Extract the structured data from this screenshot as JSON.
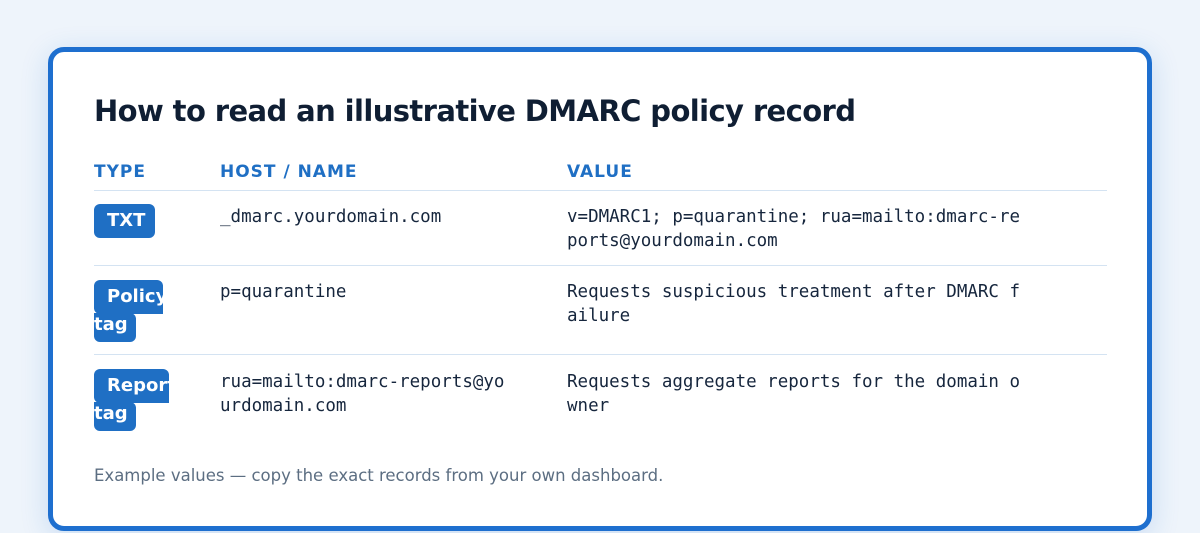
{
  "card": {
    "title": "How to read an illustrative DMARC policy record",
    "columns": [
      "TYPE",
      "HOST / NAME",
      "VALUE"
    ],
    "rows": [
      {
        "type_line1": "TXT",
        "type_line2": "",
        "host_lines": [
          "_dmarc.yourdomain.com"
        ],
        "value_lines": [
          "v=DMARC1; p=quarantine; rua=mailto:dmarc-re",
          "ports@yourdomain.com"
        ]
      },
      {
        "type_line1": "Policy",
        "type_line2": "tag",
        "host_lines": [
          "p=quarantine"
        ],
        "value_lines": [
          "Requests suspicious treatment after DMARC f",
          "ailure"
        ]
      },
      {
        "type_line1": "Report",
        "type_line2": "tag",
        "host_lines": [
          "rua=mailto:dmarc-reports@yo",
          "urdomain.com"
        ],
        "value_lines": [
          "Requests aggregate reports for the domain o",
          "wner"
        ]
      }
    ],
    "footnote": "Example values — copy the exact records from your own dashboard."
  },
  "colors": {
    "accent": "#1f6fc4",
    "border": "#1e6fcf",
    "title": "#0f1e33",
    "text": "#16263d",
    "muted": "#5c6e82",
    "divider": "#d4e3f2",
    "background": "#eef4fb"
  }
}
